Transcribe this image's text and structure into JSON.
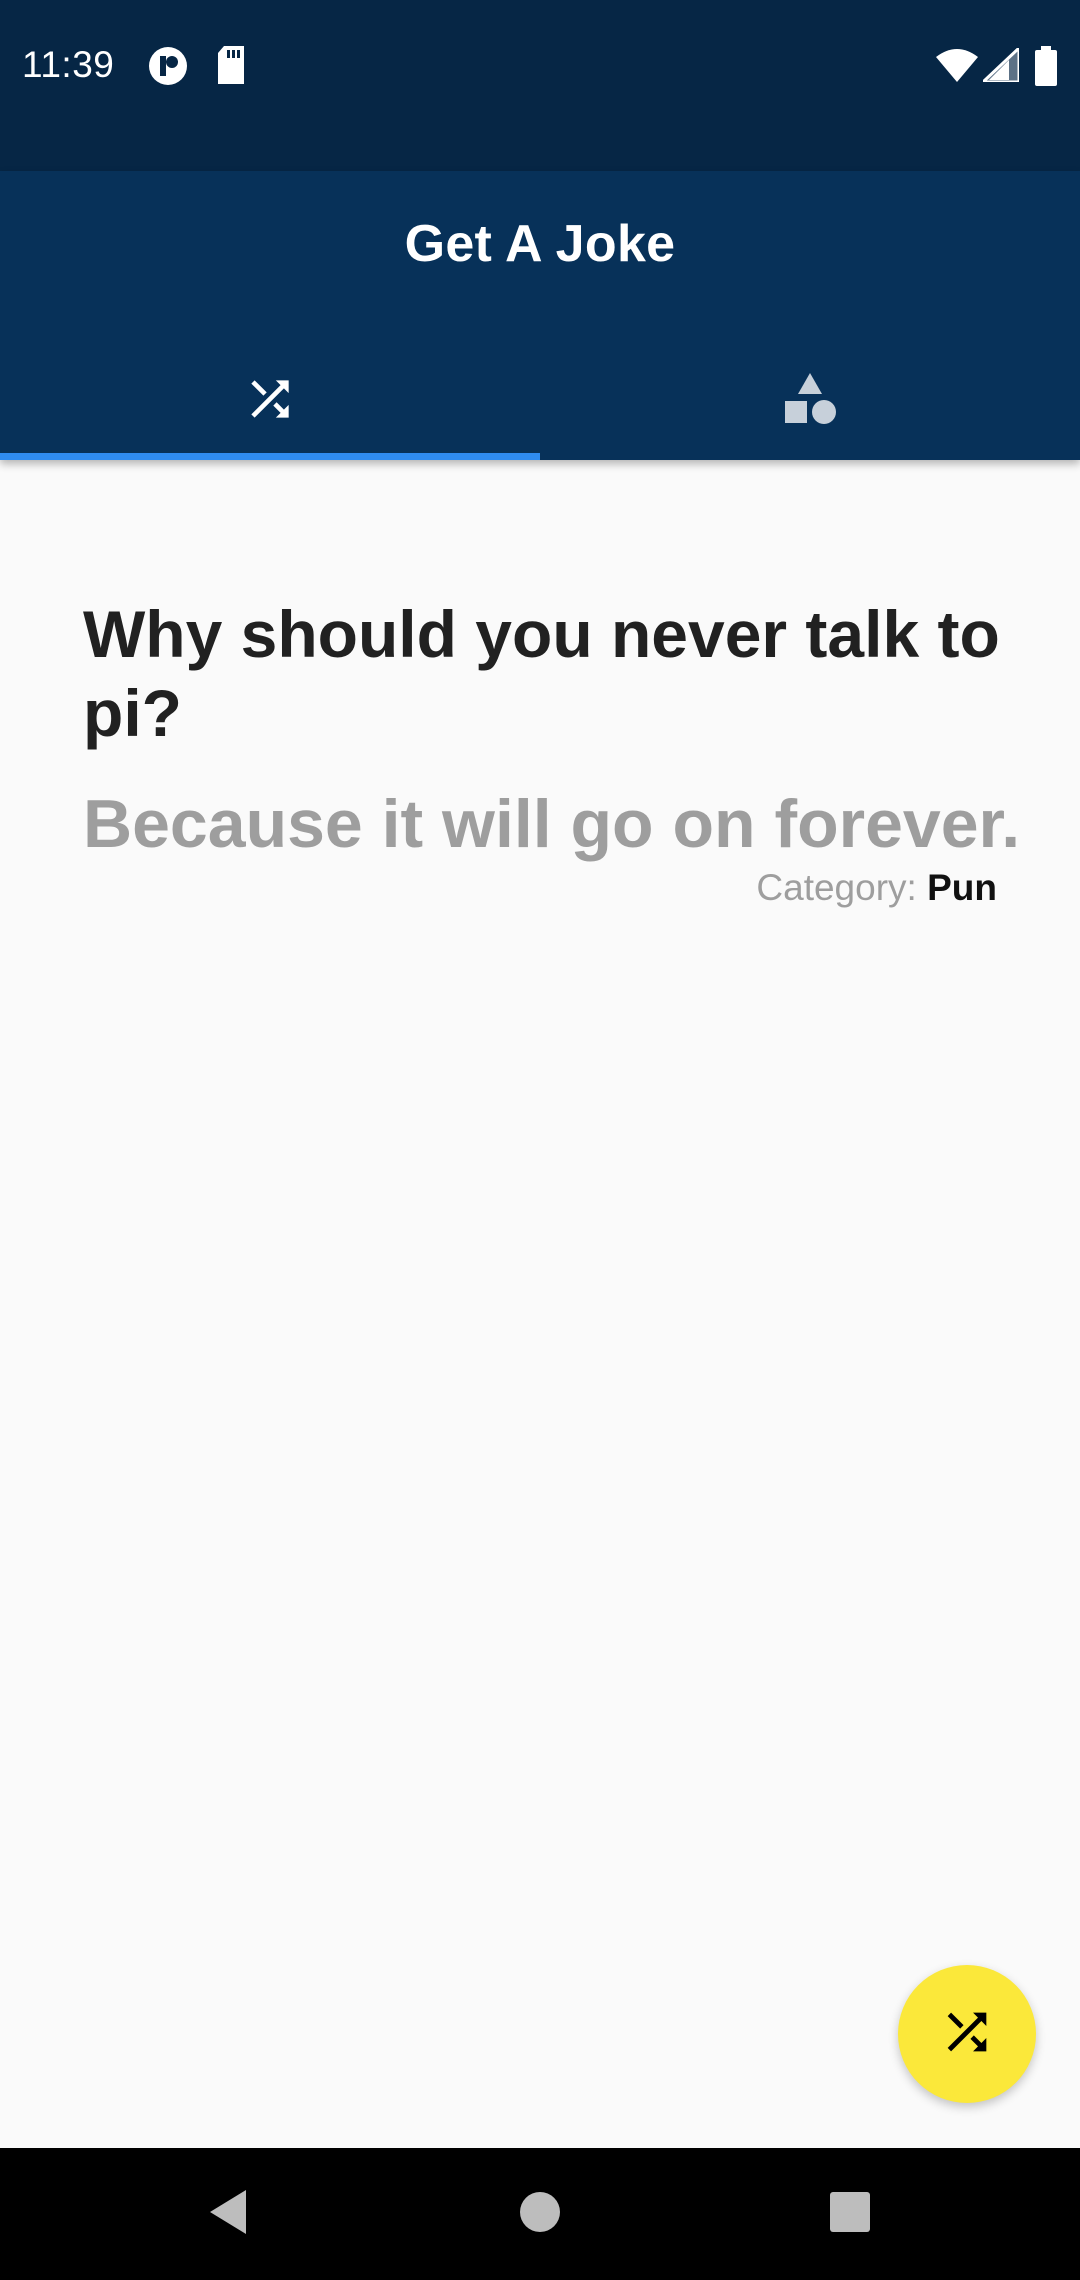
{
  "status_bar": {
    "time": "11:39",
    "icons": [
      "alert-icon",
      "sd-card-icon",
      "wifi-icon",
      "signal-icon",
      "battery-icon"
    ]
  },
  "app_bar": {
    "title": "Get A Joke",
    "tabs": [
      {
        "icon": "shuffle-icon",
        "selected": true
      },
      {
        "icon": "category-shapes-icon",
        "selected": false
      }
    ],
    "indicator_color": "#2f8cf0"
  },
  "joke": {
    "setup": "Why should you never talk to pi?",
    "delivery": "Because it will go on forever.",
    "category_label": "Category:",
    "category_value": "Pun"
  },
  "fab": {
    "icon": "shuffle-icon",
    "color": "#fbe83a"
  },
  "nav_bar": {
    "buttons": [
      "back-icon",
      "home-icon",
      "recents-icon"
    ]
  },
  "colors": {
    "status_bar_bg": "#062645",
    "app_bar_bg": "#073159",
    "background": "#fafafa"
  }
}
